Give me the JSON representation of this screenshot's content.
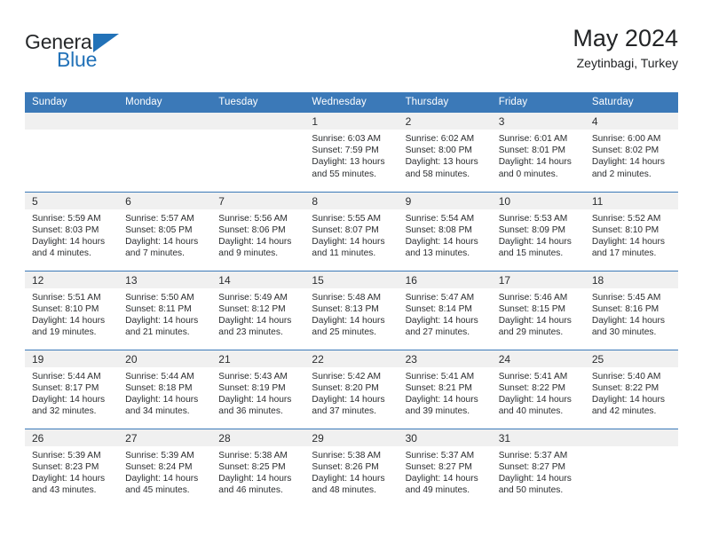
{
  "brand": {
    "name_part1": "General",
    "name_part2": "Blue",
    "accent_color": "#2272b8"
  },
  "header": {
    "title": "May 2024",
    "subtitle": "Zeytinbagi, Turkey"
  },
  "theme": {
    "header_row_bg": "#3b79b8",
    "day_strip_bg": "#f0f0f0",
    "text_color": "#2b2d2f",
    "grid_line": "#3b79b8"
  },
  "labels": {
    "sunrise": "Sunrise:",
    "sunset": "Sunset:",
    "daylight": "Daylight:"
  },
  "weekday_headers": [
    "Sunday",
    "Monday",
    "Tuesday",
    "Wednesday",
    "Thursday",
    "Friday",
    "Saturday"
  ],
  "weeks": [
    [
      {
        "day": "",
        "empty": true
      },
      {
        "day": "",
        "empty": true
      },
      {
        "day": "",
        "empty": true
      },
      {
        "day": "1",
        "sunrise": "Sunrise: 6:03 AM",
        "sunset": "Sunset: 7:59 PM",
        "daylight": "Daylight: 13 hours and 55 minutes."
      },
      {
        "day": "2",
        "sunrise": "Sunrise: 6:02 AM",
        "sunset": "Sunset: 8:00 PM",
        "daylight": "Daylight: 13 hours and 58 minutes."
      },
      {
        "day": "3",
        "sunrise": "Sunrise: 6:01 AM",
        "sunset": "Sunset: 8:01 PM",
        "daylight": "Daylight: 14 hours and 0 minutes."
      },
      {
        "day": "4",
        "sunrise": "Sunrise: 6:00 AM",
        "sunset": "Sunset: 8:02 PM",
        "daylight": "Daylight: 14 hours and 2 minutes."
      }
    ],
    [
      {
        "day": "5",
        "sunrise": "Sunrise: 5:59 AM",
        "sunset": "Sunset: 8:03 PM",
        "daylight": "Daylight: 14 hours and 4 minutes."
      },
      {
        "day": "6",
        "sunrise": "Sunrise: 5:57 AM",
        "sunset": "Sunset: 8:05 PM",
        "daylight": "Daylight: 14 hours and 7 minutes."
      },
      {
        "day": "7",
        "sunrise": "Sunrise: 5:56 AM",
        "sunset": "Sunset: 8:06 PM",
        "daylight": "Daylight: 14 hours and 9 minutes."
      },
      {
        "day": "8",
        "sunrise": "Sunrise: 5:55 AM",
        "sunset": "Sunset: 8:07 PM",
        "daylight": "Daylight: 14 hours and 11 minutes."
      },
      {
        "day": "9",
        "sunrise": "Sunrise: 5:54 AM",
        "sunset": "Sunset: 8:08 PM",
        "daylight": "Daylight: 14 hours and 13 minutes."
      },
      {
        "day": "10",
        "sunrise": "Sunrise: 5:53 AM",
        "sunset": "Sunset: 8:09 PM",
        "daylight": "Daylight: 14 hours and 15 minutes."
      },
      {
        "day": "11",
        "sunrise": "Sunrise: 5:52 AM",
        "sunset": "Sunset: 8:10 PM",
        "daylight": "Daylight: 14 hours and 17 minutes."
      }
    ],
    [
      {
        "day": "12",
        "sunrise": "Sunrise: 5:51 AM",
        "sunset": "Sunset: 8:10 PM",
        "daylight": "Daylight: 14 hours and 19 minutes."
      },
      {
        "day": "13",
        "sunrise": "Sunrise: 5:50 AM",
        "sunset": "Sunset: 8:11 PM",
        "daylight": "Daylight: 14 hours and 21 minutes."
      },
      {
        "day": "14",
        "sunrise": "Sunrise: 5:49 AM",
        "sunset": "Sunset: 8:12 PM",
        "daylight": "Daylight: 14 hours and 23 minutes."
      },
      {
        "day": "15",
        "sunrise": "Sunrise: 5:48 AM",
        "sunset": "Sunset: 8:13 PM",
        "daylight": "Daylight: 14 hours and 25 minutes."
      },
      {
        "day": "16",
        "sunrise": "Sunrise: 5:47 AM",
        "sunset": "Sunset: 8:14 PM",
        "daylight": "Daylight: 14 hours and 27 minutes."
      },
      {
        "day": "17",
        "sunrise": "Sunrise: 5:46 AM",
        "sunset": "Sunset: 8:15 PM",
        "daylight": "Daylight: 14 hours and 29 minutes."
      },
      {
        "day": "18",
        "sunrise": "Sunrise: 5:45 AM",
        "sunset": "Sunset: 8:16 PM",
        "daylight": "Daylight: 14 hours and 30 minutes."
      }
    ],
    [
      {
        "day": "19",
        "sunrise": "Sunrise: 5:44 AM",
        "sunset": "Sunset: 8:17 PM",
        "daylight": "Daylight: 14 hours and 32 minutes."
      },
      {
        "day": "20",
        "sunrise": "Sunrise: 5:44 AM",
        "sunset": "Sunset: 8:18 PM",
        "daylight": "Daylight: 14 hours and 34 minutes."
      },
      {
        "day": "21",
        "sunrise": "Sunrise: 5:43 AM",
        "sunset": "Sunset: 8:19 PM",
        "daylight": "Daylight: 14 hours and 36 minutes."
      },
      {
        "day": "22",
        "sunrise": "Sunrise: 5:42 AM",
        "sunset": "Sunset: 8:20 PM",
        "daylight": "Daylight: 14 hours and 37 minutes."
      },
      {
        "day": "23",
        "sunrise": "Sunrise: 5:41 AM",
        "sunset": "Sunset: 8:21 PM",
        "daylight": "Daylight: 14 hours and 39 minutes."
      },
      {
        "day": "24",
        "sunrise": "Sunrise: 5:41 AM",
        "sunset": "Sunset: 8:22 PM",
        "daylight": "Daylight: 14 hours and 40 minutes."
      },
      {
        "day": "25",
        "sunrise": "Sunrise: 5:40 AM",
        "sunset": "Sunset: 8:22 PM",
        "daylight": "Daylight: 14 hours and 42 minutes."
      }
    ],
    [
      {
        "day": "26",
        "sunrise": "Sunrise: 5:39 AM",
        "sunset": "Sunset: 8:23 PM",
        "daylight": "Daylight: 14 hours and 43 minutes."
      },
      {
        "day": "27",
        "sunrise": "Sunrise: 5:39 AM",
        "sunset": "Sunset: 8:24 PM",
        "daylight": "Daylight: 14 hours and 45 minutes."
      },
      {
        "day": "28",
        "sunrise": "Sunrise: 5:38 AM",
        "sunset": "Sunset: 8:25 PM",
        "daylight": "Daylight: 14 hours and 46 minutes."
      },
      {
        "day": "29",
        "sunrise": "Sunrise: 5:38 AM",
        "sunset": "Sunset: 8:26 PM",
        "daylight": "Daylight: 14 hours and 48 minutes."
      },
      {
        "day": "30",
        "sunrise": "Sunrise: 5:37 AM",
        "sunset": "Sunset: 8:27 PM",
        "daylight": "Daylight: 14 hours and 49 minutes."
      },
      {
        "day": "31",
        "sunrise": "Sunrise: 5:37 AM",
        "sunset": "Sunset: 8:27 PM",
        "daylight": "Daylight: 14 hours and 50 minutes."
      },
      {
        "day": "",
        "empty": true
      }
    ]
  ]
}
